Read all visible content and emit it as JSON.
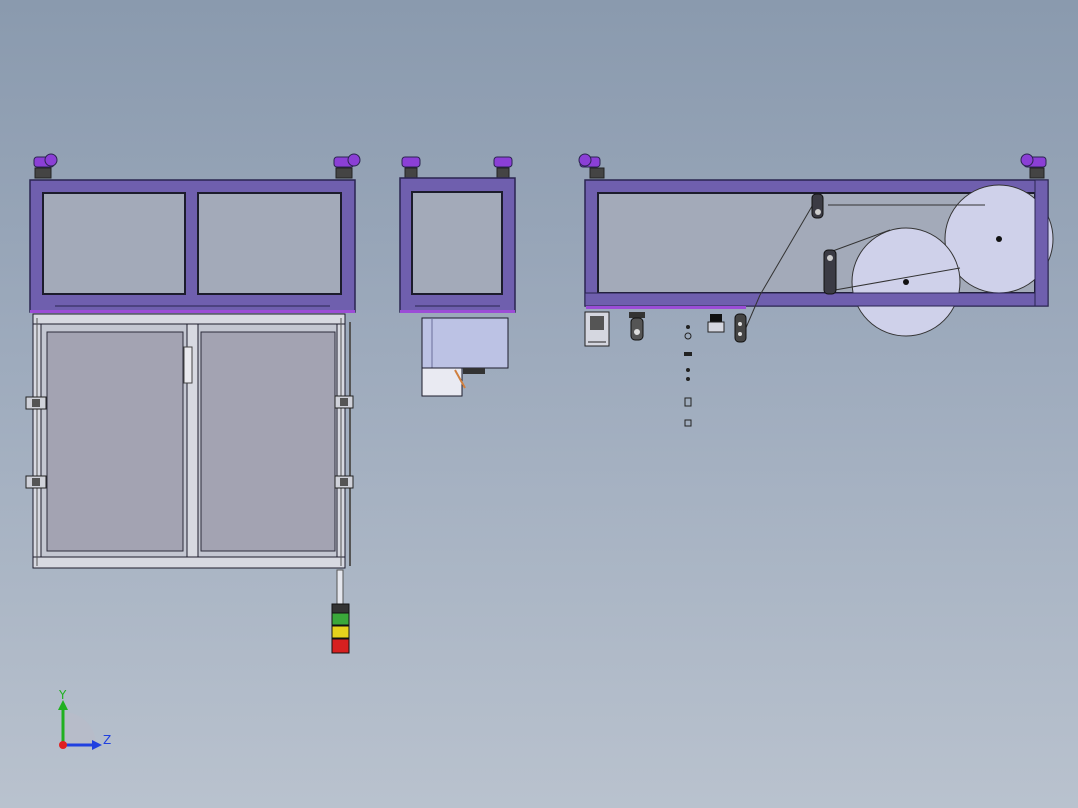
{
  "app": {
    "window_title": "",
    "view_type": "cad-3d-model-viewport",
    "background": {
      "top": "#8a9aae",
      "bottom": "#b9c2ce"
    }
  },
  "colors": {
    "frame_purple": "#6f5fae",
    "frame_edge": "#2a2450",
    "caster_purple": "#8b3fd6",
    "panel_gray": "#a3a3b2",
    "aluminum": "#c4c7d2",
    "roller_fill": "#cfd1ea",
    "motor_fill": "#bcc2e4",
    "light_green": "#3aa83a",
    "light_yellow": "#e6d21c",
    "light_red": "#d62020",
    "axis_x": "#e02020",
    "axis_y": "#20b020",
    "axis_z": "#2040e0"
  },
  "triad": {
    "y_label": "Y",
    "z_label": "Z",
    "x_icon": "x-axis-icon",
    "y_icon": "y-axis-icon",
    "z_icon": "z-axis-icon"
  },
  "views": [
    {
      "id": "front-view",
      "name": "front-view"
    },
    {
      "id": "side-view",
      "name": "side-view"
    },
    {
      "id": "end-view",
      "name": "end-view"
    }
  ]
}
